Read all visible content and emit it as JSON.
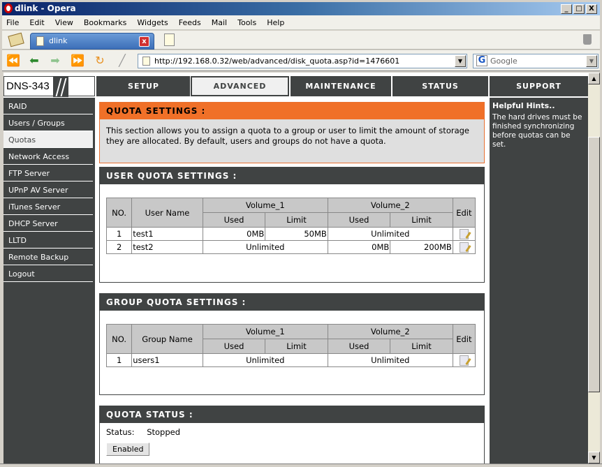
{
  "window": {
    "title": "dlink - Opera",
    "controls": [
      "_",
      "□",
      "X"
    ]
  },
  "menu": [
    "File",
    "Edit",
    "View",
    "Bookmarks",
    "Widgets",
    "Feeds",
    "Mail",
    "Tools",
    "Help"
  ],
  "tabs": [
    {
      "label": "dlink",
      "close": "x"
    }
  ],
  "address": {
    "url": "http://192.168.0.32/web/advanced/disk_quota.asp?id=1476601",
    "search_placeholder": "Google"
  },
  "device": {
    "model": "DNS-343"
  },
  "topnav": [
    "SETUP",
    "ADVANCED",
    "MAINTENANCE",
    "STATUS",
    "SUPPORT"
  ],
  "sidebar": [
    "RAID",
    "Users / Groups",
    "Quotas",
    "Network Access",
    "FTP Server",
    "UPnP AV Server",
    "iTunes Server",
    "DHCP Server",
    "LLTD",
    "Remote Backup",
    "Logout"
  ],
  "quota_settings": {
    "title": "QUOTA SETTINGS :",
    "text": "This section allows you to assign a quota to a group or user to limit the amount of storage they are allocated. By default, users and groups do not have a quota."
  },
  "user_quota": {
    "title": "USER QUOTA SETTINGS :",
    "headers": {
      "no": "NO.",
      "name": "User Name",
      "vol1": "Volume_1",
      "vol2": "Volume_2",
      "used": "Used",
      "limit": "Limit",
      "edit": "Edit"
    },
    "rows": [
      {
        "no": "1",
        "name": "test1",
        "v1_used": "0MB",
        "v1_limit": "50MB",
        "v2": "Unlimited"
      },
      {
        "no": "2",
        "name": "test2",
        "v1": "Unlimited",
        "v2_used": "0MB",
        "v2_limit": "200MB"
      }
    ]
  },
  "group_quota": {
    "title": "GROUP QUOTA SETTINGS :",
    "headers": {
      "no": "NO.",
      "name": "Group Name",
      "vol1": "Volume_1",
      "vol2": "Volume_2",
      "used": "Used",
      "limit": "Limit",
      "edit": "Edit"
    },
    "rows": [
      {
        "no": "1",
        "name": "users1",
        "v1": "Unlimited",
        "v2": "Unlimited"
      }
    ]
  },
  "quota_status": {
    "title": "QUOTA STATUS :",
    "label": "Status:",
    "value": "Stopped",
    "button": "Enabled"
  },
  "hints": {
    "title": "Helpful Hints..",
    "text": "The hard drives must be finished synchronizing before quotas can be set."
  }
}
